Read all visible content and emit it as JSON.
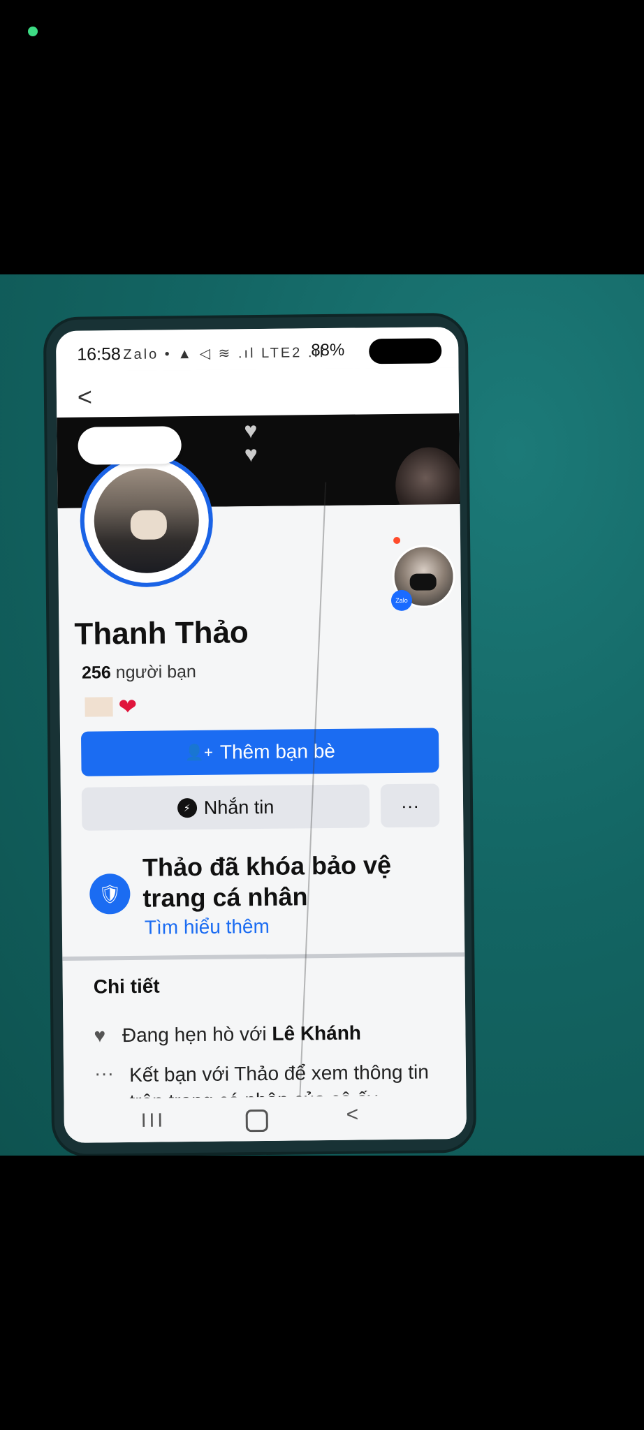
{
  "status_bar": {
    "time": "16:58",
    "icons": "Zalo • ▲ ◁ ≋ .ıl LTE2 .ıl",
    "battery": "88%"
  },
  "header": {
    "back_glyph": "<"
  },
  "profile": {
    "name": "Thanh Thảo",
    "friends_count": "256",
    "friends_label": "người bạn",
    "bio_heart": "❤",
    "zalo_badge": "Zalo"
  },
  "actions": {
    "add_friend_icon": "👤+",
    "add_friend": "Thêm bạn bè",
    "message_icon": "⚡",
    "message": "Nhắn tin",
    "more": "···"
  },
  "lock_notice": {
    "icon": "🛡",
    "title": "Thảo đã khóa bảo vệ trang cá nhân",
    "link": "Tìm hiểu thêm"
  },
  "details": {
    "title": "Chi tiết",
    "relationship_prefix": "Đang hẹn hò với",
    "relationship_name": "Lê Khánh",
    "more_icon": "···",
    "locked_info": "Kết bạn với Thảo để xem thông tin trên trang cá nhân của cô ấy"
  },
  "nav": {
    "recent": "III",
    "back": "<"
  }
}
